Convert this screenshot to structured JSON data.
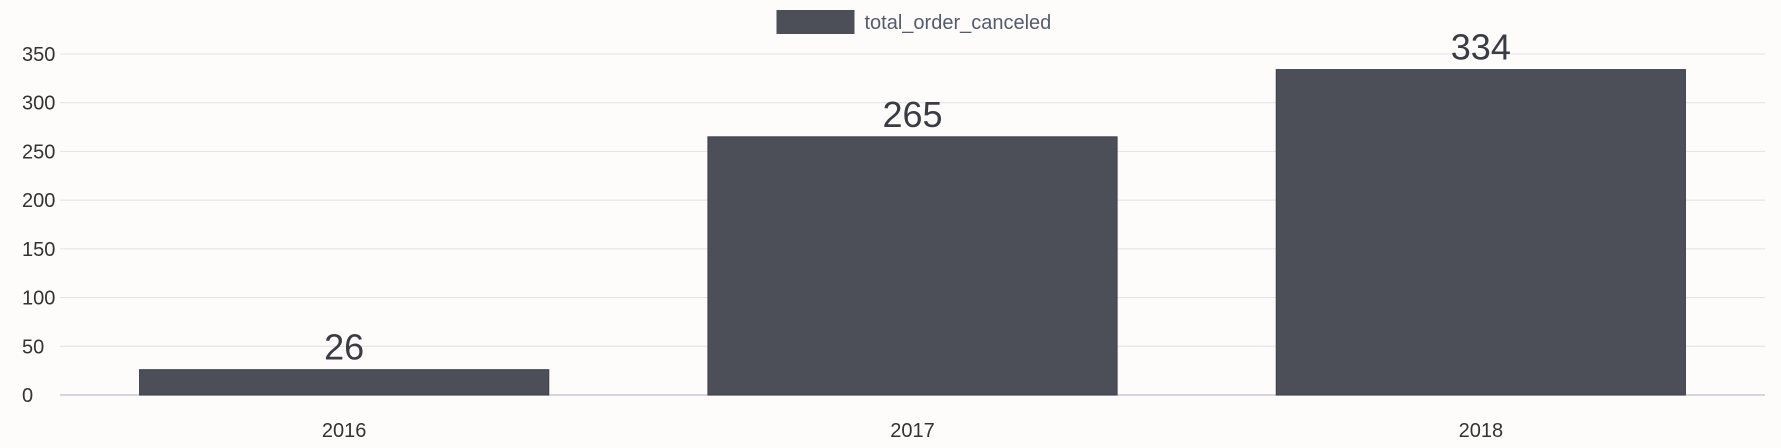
{
  "chart_data": {
    "type": "bar",
    "categories": [
      "2016",
      "2017",
      "2018"
    ],
    "series": [
      {
        "name": "total_order_canceled",
        "values": [
          26,
          265,
          334
        ]
      }
    ],
    "ylim": [
      0,
      350
    ],
    "yticks": [
      0,
      50,
      100,
      150,
      200,
      250,
      300,
      350
    ],
    "grid": true,
    "legend": "top-center",
    "data_labels": true,
    "colors": {
      "bar": "#4d4f58",
      "grid": "#e2e0e8",
      "axis": "#c9c6d6"
    }
  }
}
